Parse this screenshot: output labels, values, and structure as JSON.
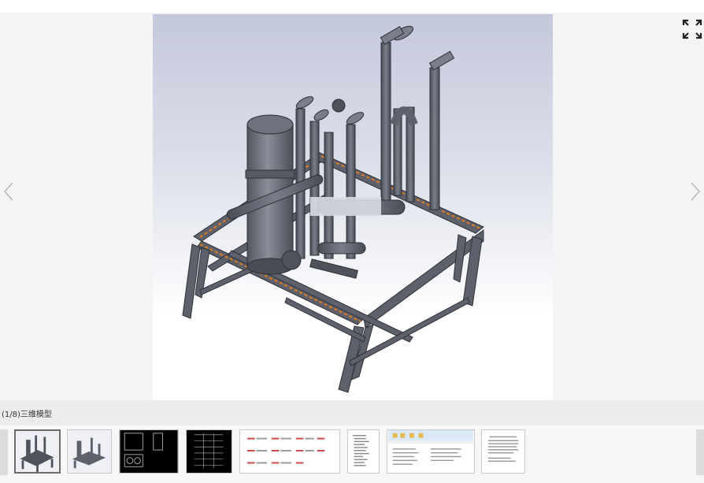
{
  "viewer": {
    "caption": "(1/8)三维模型",
    "current_index": 1,
    "total": 8
  },
  "icons": {
    "prev": "chevron-left-icon",
    "next": "chevron-right-icon",
    "fullscreen": "expand-icon"
  },
  "thumbnails": [
    {
      "kind": "3d-model"
    },
    {
      "kind": "3d-model-alt"
    },
    {
      "kind": "cad-drawing-dark"
    },
    {
      "kind": "cad-table-dark"
    },
    {
      "kind": "parts-list"
    },
    {
      "kind": "document-list"
    },
    {
      "kind": "file-explorer"
    },
    {
      "kind": "document-page"
    }
  ],
  "colors": {
    "frame": "#5c5f68",
    "frame_dark": "#3b3d44",
    "accent_orange": "#e07c1a"
  }
}
